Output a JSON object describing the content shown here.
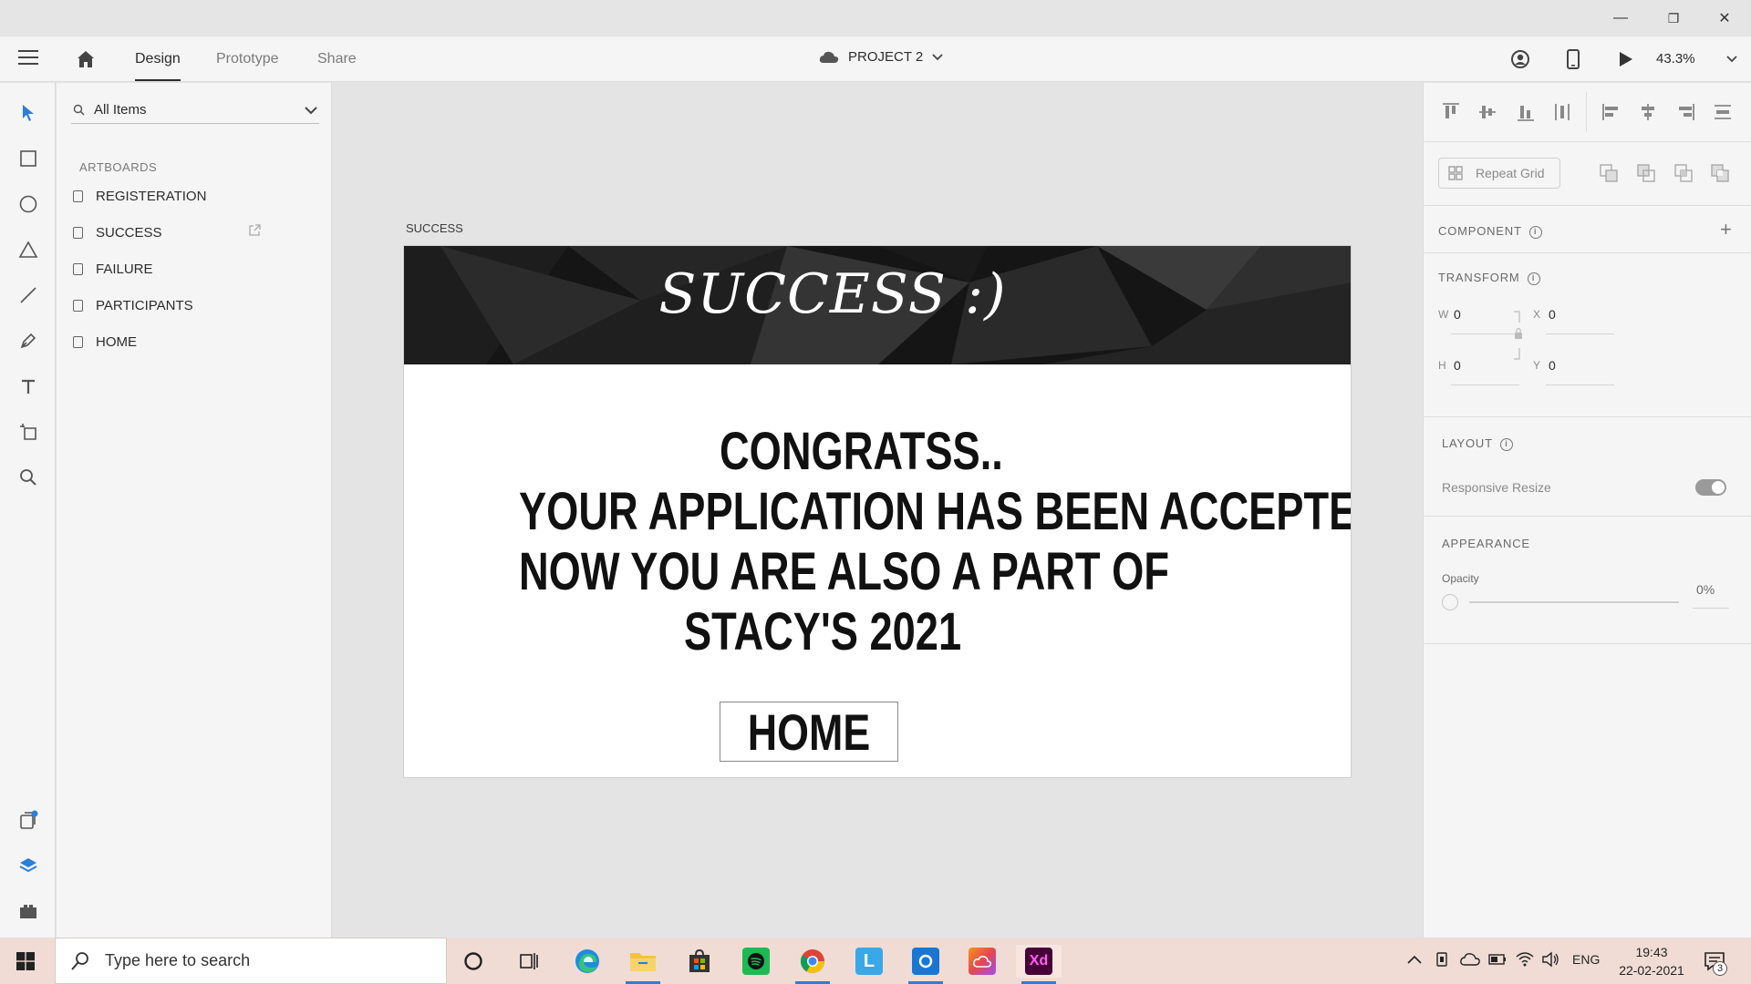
{
  "window": {
    "minimize": "—",
    "maximize": "❐",
    "close": "✕"
  },
  "header": {
    "tabs": [
      {
        "label": "Design"
      },
      {
        "label": "Prototype"
      },
      {
        "label": "Share"
      }
    ],
    "project_name": "PROJECT 2",
    "zoom": "43.3%"
  },
  "layers": {
    "search_label": "All Items",
    "section": "ARTBOARDS",
    "items": [
      {
        "label": "REGISTERATION"
      },
      {
        "label": "SUCCESS"
      },
      {
        "label": "FAILURE"
      },
      {
        "label": "PARTICIPANTS"
      },
      {
        "label": "HOME"
      }
    ]
  },
  "canvas": {
    "artboard_name": "SUCCESS",
    "banner_title": "SUCCESS :)",
    "lines": [
      "CONGRATSS..",
      "YOUR APPLICATION HAS BEEN ACCEPTED",
      "NOW YOU ARE ALSO  A PART OF",
      "STACY'S 2021"
    ],
    "home_button": "HOME"
  },
  "props": {
    "repeat_grid": "Repeat Grid",
    "component": "COMPONENT",
    "transform": "TRANSFORM",
    "w_label": "W",
    "w_value": "0",
    "x_label": "X",
    "x_value": "0",
    "h_label": "H",
    "h_value": "0",
    "y_label": "Y",
    "y_value": "0",
    "layout": "LAYOUT",
    "responsive_resize": "Responsive Resize",
    "appearance": "APPEARANCE",
    "opacity_label": "Opacity",
    "opacity_value": "0%"
  },
  "taskbar": {
    "search_placeholder": "Type here to search",
    "language": "ENG",
    "time": "19:43",
    "date": "22-02-2021",
    "notifications": "3"
  },
  "colors": {
    "accent": "#2a7fd6",
    "xd_brand": "#470137",
    "spotify": "#1db954"
  }
}
